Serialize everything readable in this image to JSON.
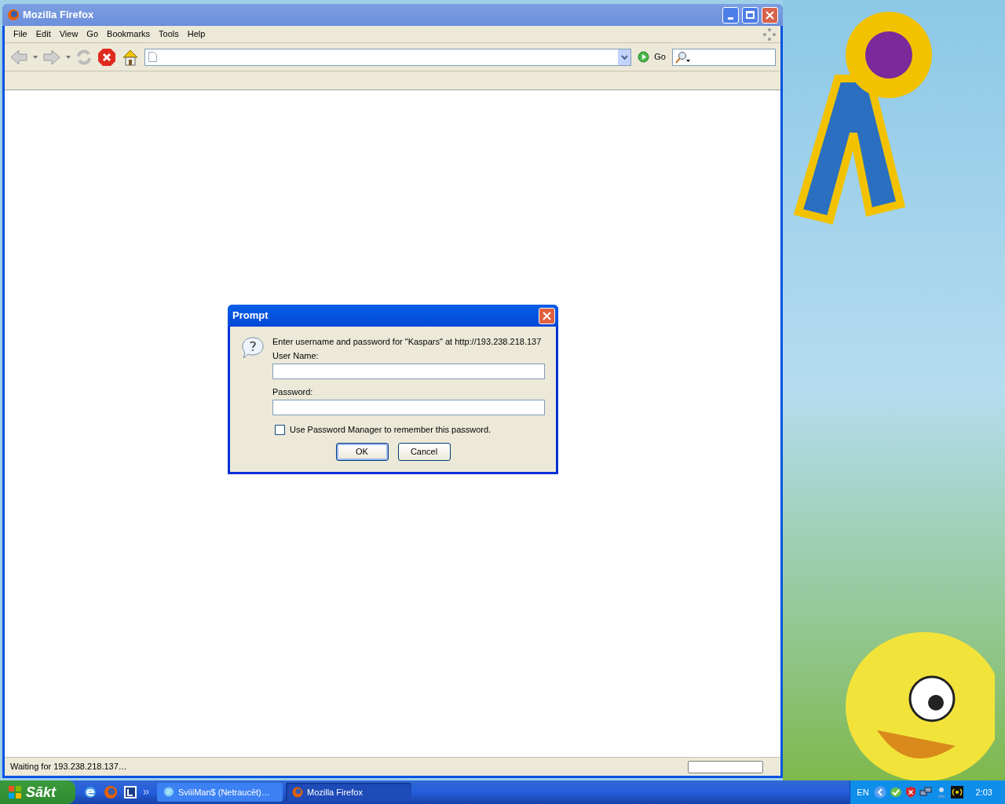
{
  "window": {
    "title": "Mozilla Firefox"
  },
  "menu": [
    "File",
    "Edit",
    "View",
    "Go",
    "Bookmarks",
    "Tools",
    "Help"
  ],
  "toolbar": {
    "go_button": "Go"
  },
  "status_bar": {
    "text": "Waiting for 193.238.218.137…",
    "progress": {
      "level": 0
    }
  },
  "dialog": {
    "title": "Prompt",
    "message": "Enter username and password for \"Kaspars\" at http://193.238.218.137",
    "fields": [
      {
        "label": "User Name:"
      },
      {
        "label": "Password:"
      }
    ],
    "remember": {
      "label": "Use Password Manager to remember this password.",
      "checked": false
    },
    "buttons": [
      {
        "label": "OK",
        "default": true
      },
      {
        "label": "Cancel",
        "default": false
      }
    ]
  },
  "taskbar": {
    "start": "Sākt",
    "tasks": [
      {
        "label": "SviiiMan$ (Netraucēt)…",
        "selected": false,
        "kind": "chat"
      },
      {
        "label": "Mozilla Firefox",
        "selected": true,
        "kind": "browser"
      }
    ],
    "language": "EN",
    "clock": "2:03"
  }
}
